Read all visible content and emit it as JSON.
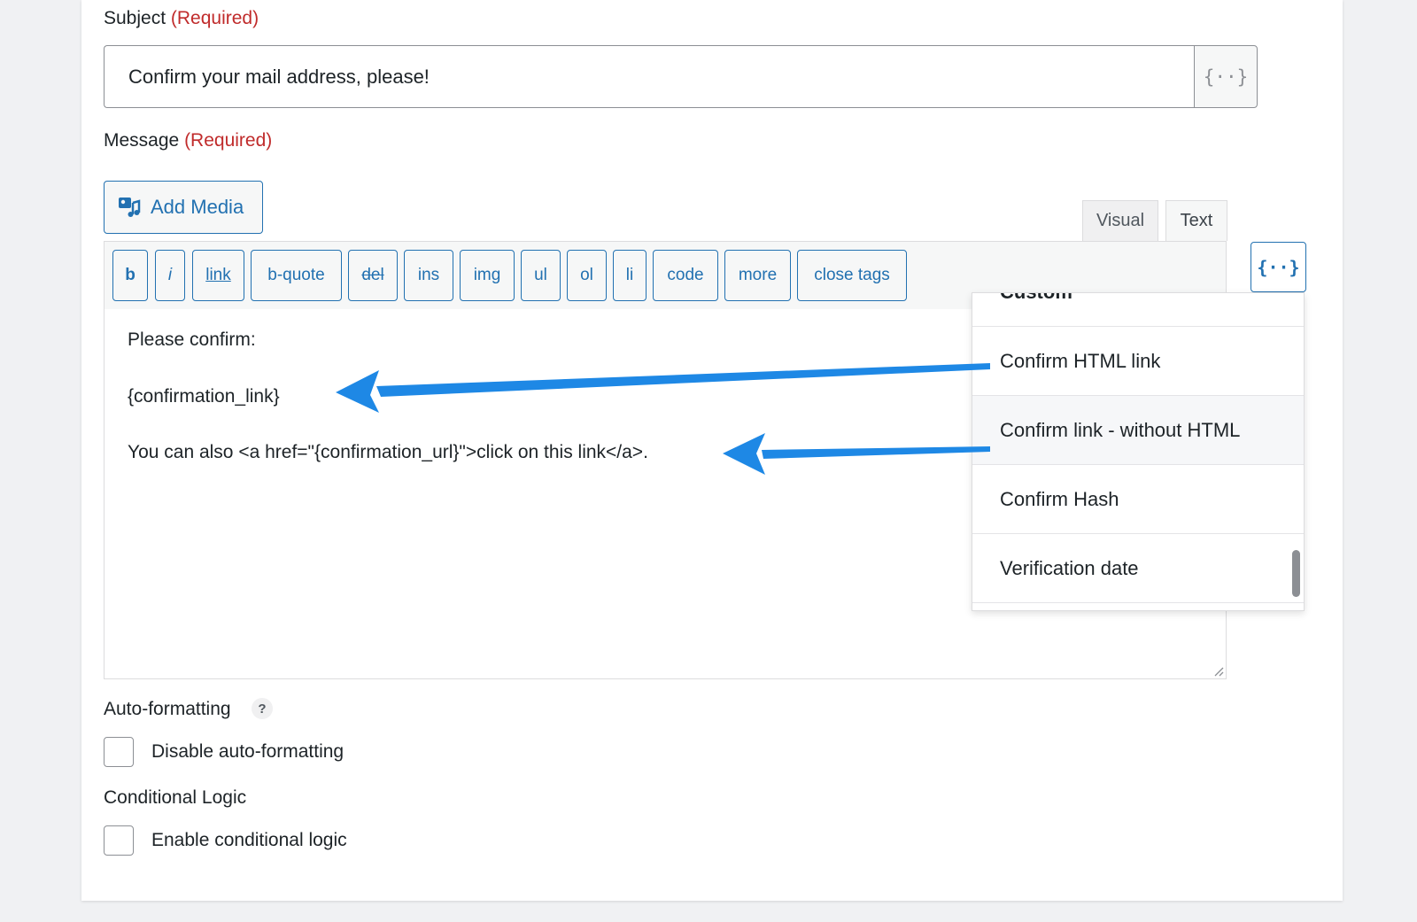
{
  "subject": {
    "label": "Subject",
    "required": "(Required)",
    "value": "Confirm your mail address, please!",
    "merge_tag_icon": "{··}"
  },
  "message": {
    "label": "Message",
    "required": "(Required)",
    "add_media": "Add Media",
    "tabs": {
      "visual": "Visual",
      "text": "Text"
    },
    "toolbar": {
      "b": "b",
      "i": "i",
      "link": "link",
      "bquote": "b-quote",
      "del": "del",
      "ins": "ins",
      "img": "img",
      "ul": "ul",
      "ol": "ol",
      "li": "li",
      "code": "code",
      "more": "more",
      "close_tags": "close tags"
    },
    "merge_tag_icon": "{··}",
    "content": {
      "line1": "Please confirm:",
      "line2": "{confirmation_link}",
      "line3": "You can also <a href=\"{confirmation_url}\">click on this link</a>."
    }
  },
  "merge_tags_dropdown": {
    "partial_item": "Custom",
    "items": [
      "Confirm HTML link",
      "Confirm link - without HTML",
      "Confirm Hash",
      "Verification date"
    ],
    "highlighted_index": 1
  },
  "auto_formatting": {
    "label": "Auto-formatting",
    "help": "?",
    "checkbox_label": "Disable auto-formatting",
    "checked": false
  },
  "conditional_logic": {
    "label": "Conditional Logic",
    "checkbox_label": "Enable conditional logic",
    "checked": false
  },
  "colors": {
    "accent": "#2271b1",
    "required": "#c02b2b",
    "annotation_arrow": "#1e88e5"
  }
}
